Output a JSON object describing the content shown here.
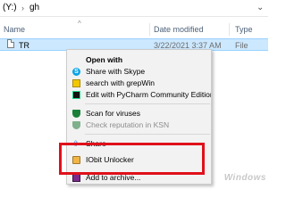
{
  "address_bar": {
    "drive": "(Y:)",
    "separator": "›",
    "folder": "gh",
    "chevron": "⌄"
  },
  "columns": {
    "name": "Name",
    "date_modified": "Date modified",
    "type": "Type",
    "sort_caret": "^"
  },
  "file_row": {
    "name": "TR",
    "date_modified": "3/22/2021 3:37 AM",
    "type": "File"
  },
  "context_menu": {
    "open_with": "Open with",
    "share_skype": "Share with Skype",
    "search_grepwin": "search with grepWin",
    "edit_pycharm": "Edit with PyCharm Community Edition",
    "scan_viruses": "Scan for viruses",
    "check_ksn": "Check reputation in KSN",
    "share": "Share",
    "iobit_unlocker": "IObit Unlocker",
    "add_archive": "Add to archive..."
  },
  "watermark": "Windows",
  "colors": {
    "selection": "#cce8ff",
    "highlight_box": "#e0101a"
  }
}
